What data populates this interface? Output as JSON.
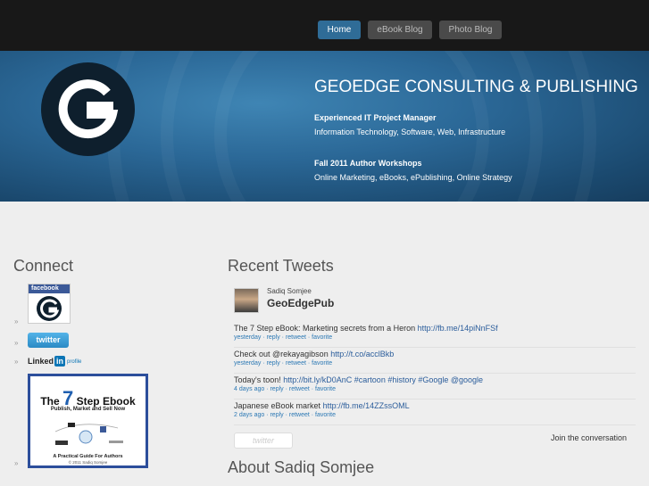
{
  "nav": {
    "items": [
      {
        "label": "Home",
        "active": true
      },
      {
        "label": "eBook Blog",
        "active": false
      },
      {
        "label": "Photo Blog",
        "active": false
      }
    ]
  },
  "hero": {
    "title": "GEOEDGE CONSULTING & PUBLISHING",
    "line1_heading": "Experienced IT Project Manager",
    "line1_text": "Information Technology, Software, Web, Infrastructure",
    "line2_heading": "Fall 2011 Author Workshops",
    "line2_text": "Online Marketing, eBooks, ePublishing, Online Strategy",
    "logo_letter": "G"
  },
  "connect": {
    "title": "Connect",
    "facebook_label": "facebook",
    "facebook_logo_letter": "G",
    "twitter_label": "twitter",
    "linkedin_text": "Linked",
    "linkedin_in": "in",
    "linkedin_profile": "profile",
    "arrow": "»",
    "ebook": {
      "title_prefix": "The",
      "title_number": "7",
      "title_suffix": "Step Ebook",
      "subtitle": "Publish, Market and Sell Now",
      "caption": "A Practical Guide For Authors",
      "copyright": "© 2011  Sadiq Somjee"
    }
  },
  "tweets": {
    "title": "Recent Tweets",
    "user_name": "Sadiq Somjee",
    "handle": "GeoEdgePub",
    "items": [
      {
        "text": "The 7 Step eBook: Marketing secrets from a Heron ",
        "link": "http://fb.me/14piNnFSf",
        "meta": "yesterday · reply · retweet · favorite"
      },
      {
        "text": "Check out @rekayagibson ",
        "link": "http://t.co/acclBkb",
        "meta": "yesterday · reply · retweet · favorite"
      },
      {
        "text": "Today's toon! ",
        "link": "http://bit.ly/kD0AnC #cartoon #history #Google @google",
        "meta": "4 days ago · reply · retweet · favorite"
      },
      {
        "text": "Japanese eBook market ",
        "link": "http://fb.me/14ZZssOML",
        "meta": "2 days ago · reply · retweet · favorite"
      }
    ],
    "logo_text": "twitter",
    "join_text": "Join the conversation"
  },
  "about": {
    "title": "About Sadiq Somjee"
  },
  "colors": {
    "nav_active": "#2f6c97",
    "hero_blue": "#2b6897",
    "link_blue": "#2b5d9b"
  }
}
